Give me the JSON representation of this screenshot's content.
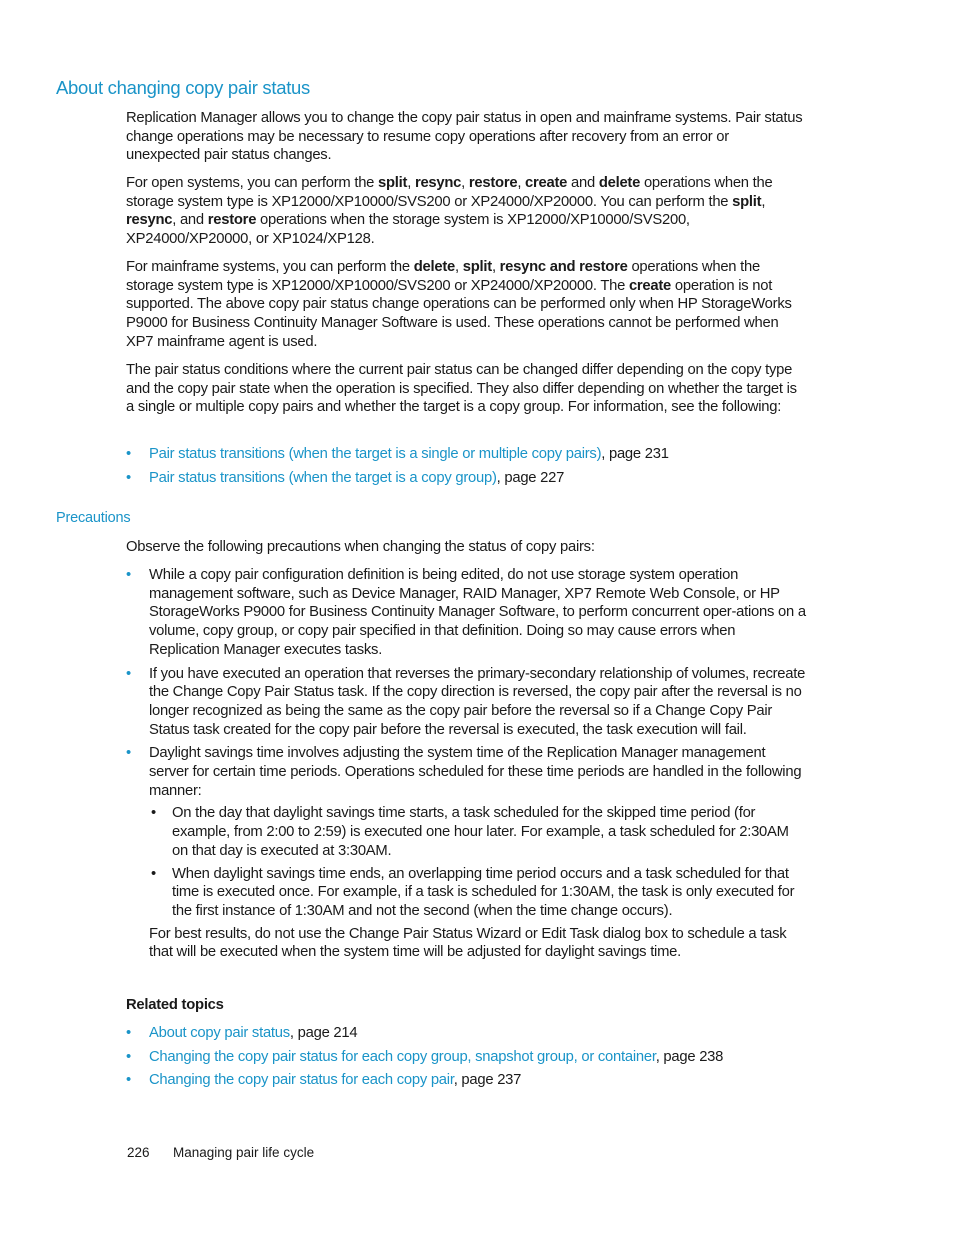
{
  "heading": "About changing copy pair status",
  "intro": "Replication Manager allows you to change the copy pair status in open and mainframe systems. Pair status change operations may be necessary to resume copy operations after recovery from an error or unexpected pair status changes.",
  "open_systems": {
    "t1": "For open systems, you can perform the ",
    "b1": "split",
    "t2": ", ",
    "b2": "resync",
    "t3": ", ",
    "b3": "restore",
    "t4": ", ",
    "b4": "create",
    "t5": " and ",
    "b5": "delete",
    "t6": " operations when the storage system type is XP12000/XP10000/SVS200 or XP24000/XP20000. You can perform the ",
    "b6": "split",
    "t7": ", ",
    "b7": "resync",
    "t8": ", and ",
    "b8": "restore",
    "t9": " operations when the storage system is XP12000/XP10000/SVS200, XP24000/XP20000, or XP1024/XP128."
  },
  "mainframe": {
    "t1": "For mainframe systems, you can perform the ",
    "b1": "delete",
    "t2": ", ",
    "b2": "split",
    "t3": ", ",
    "b3": "resync and restore",
    "t4": " operations when the storage system type is XP12000/XP10000/SVS200 or XP24000/XP20000. The ",
    "b4": "create",
    "t5": " operation is not supported. The above copy pair status change operations can be performed only when HP StorageWorks P9000 for Business Continuity Manager Software is used. These operations cannot be performed when XP7 mainframe agent is used."
  },
  "conditions": "The pair status conditions where the current pair status can be changed differ depending on the copy type and the copy pair state when the operation is specified. They also differ depending on whether the target is a single or multiple copy pairs and whether the target is a copy group. For information, see the following:",
  "see_links": [
    {
      "link": "Pair status transitions (when the target is a single or multiple copy pairs)",
      "page": ", page 231"
    },
    {
      "link": "Pair status transitions (when the target is a copy group)",
      "page": ", page 227"
    }
  ],
  "precautions": {
    "heading": "Precautions",
    "intro": "Observe the following precautions when changing the status of copy pairs:",
    "items": [
      "While a copy pair configuration definition is being edited, do not use storage system operation management software, such as Device Manager, RAID Manager, XP7 Remote Web Console, or HP StorageWorks P9000 for Business Continuity Manager Software, to perform concurrent oper-ations on a volume, copy group, or copy pair specified in that definition. Doing so may cause errors when Replication Manager executes tasks.",
      "If you have executed an operation that reverses the primary-secondary relationship of volumes, recreate the Change Copy Pair Status task. If the copy direction is reversed, the copy pair after the reversal is no longer recognized as being the same as the copy pair before the reversal so if a Change Copy Pair Status task created for the copy pair before the reversal is executed, the task execution will fail.",
      "Daylight savings time involves adjusting the system time of the Replication Manager management server for certain time periods. Operations scheduled for these time periods are handled in the following manner:"
    ],
    "sub_items": [
      "On the day that daylight savings time starts, a task scheduled for the skipped time period (for example, from 2:00 to 2:59) is executed one hour later. For example, a task scheduled for 2:30AM on that day is executed at 3:30AM.",
      "When daylight savings time ends, an overlapping time period occurs and a task scheduled for that time is executed once. For example, if a task is scheduled for 1:30AM, the task is only executed for the first instance of 1:30AM and not the second (when the time change occurs)."
    ],
    "best_results": "For best results, do not use the Change Pair Status Wizard or Edit Task dialog box to schedule a task that will be executed when the system time will be adjusted for daylight savings time."
  },
  "related": {
    "heading": "Related topics",
    "items": [
      {
        "link": "About copy pair status",
        "page": ", page 214"
      },
      {
        "link": "Changing the copy pair status for each copy group, snapshot group, or container",
        "page": ", page 238"
      },
      {
        "link": "Changing the copy pair status for each copy pair",
        "page": ", page 237"
      }
    ]
  },
  "footer": {
    "page_number": "226",
    "chapter": "Managing pair life cycle"
  }
}
